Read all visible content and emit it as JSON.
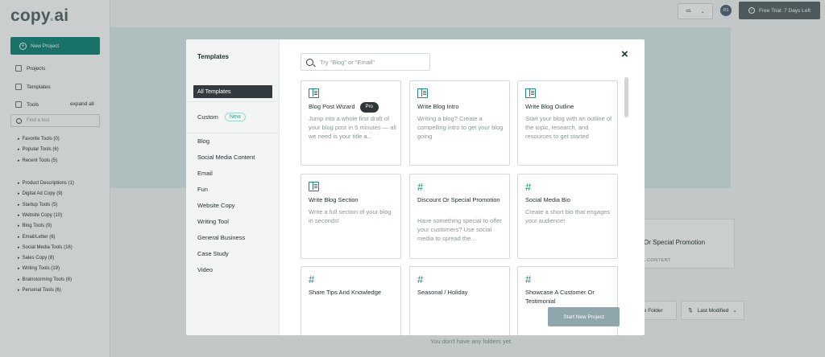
{
  "sidebar": {
    "logo_main": "copy",
    "logo_dot": ".",
    "logo_ai": "ai",
    "new_project": "New Project",
    "nav": [
      "Projects",
      "Templates",
      "Tools"
    ],
    "expand_all": "expand all",
    "find_placeholder": "Find a tool",
    "group1": [
      "Favorite Tools (0)",
      "Popular Tools (6)",
      "Recent Tools (5)"
    ],
    "group2": [
      "Product Descriptions (1)",
      "Digital Ad Copy (9)",
      "Startup Tools (5)",
      "Website Copy (10)",
      "Blog Tools (9)",
      "Email/Letter (6)",
      "Social Media Tools (16)",
      "Sales Copy (8)",
      "Writing Tools (19)",
      "Brainstorming Tools (6)",
      "Personal Tools (6)"
    ]
  },
  "topbar": {
    "lang": "us",
    "avatar": "RS",
    "trial": "Free Trial: 7 Days Left"
  },
  "background": {
    "card_title": "Or Special Promotion",
    "card_sub": "IA CONTENT",
    "create_folder": "ate Folder",
    "last_modified": "Last Modified",
    "empty_msg": "You don't have any folders yet."
  },
  "modal": {
    "title": "Templates",
    "all_templates": "All Templates",
    "custom": "Custom",
    "new_badge": "New",
    "categories": [
      "Blog",
      "Social Media Content",
      "Email",
      "Fun",
      "Website Copy",
      "Writing Tool",
      "General Business",
      "Case Study",
      "Video"
    ],
    "search_placeholder": "Try \"Blog\" or \"Email\"",
    "close": "×",
    "start_button": "Start New Project",
    "pro_badge": "Pro",
    "cards": [
      {
        "title": "Blog Post Wizard",
        "desc": "Jump into a whole first draft of your blog post in 5 minutes — all we need is your title a...",
        "icon": "book-icon"
      },
      {
        "title": "Write Blog Intro",
        "desc": "Writing a blog? Create a compelling intro to get your blog going",
        "icon": "book-icon"
      },
      {
        "title": "Write Blog Outline",
        "desc": "Start your blog with an outline of the topic, research, and resources to get started",
        "icon": "book-icon"
      },
      {
        "title": "Write Blog Section",
        "desc": "Write a full section of your blog in seconds!",
        "icon": "book-icon"
      },
      {
        "title": "Discount Or Special Promotion",
        "desc": "Have something special to offer your customers? Use social media to spread the...",
        "icon": "hash-icon"
      },
      {
        "title": "Social Media Bio",
        "desc": "Create a short bio that engages your audience!",
        "icon": "hash-icon"
      },
      {
        "title": "Share Tips And Knowledge",
        "desc": "",
        "icon": "hash-icon"
      },
      {
        "title": "Seasonal / Holiday",
        "desc": "",
        "icon": "hash-icon"
      },
      {
        "title": "Showcase A Customer Or Testimonial",
        "desc": "",
        "icon": "hash-icon"
      }
    ]
  }
}
